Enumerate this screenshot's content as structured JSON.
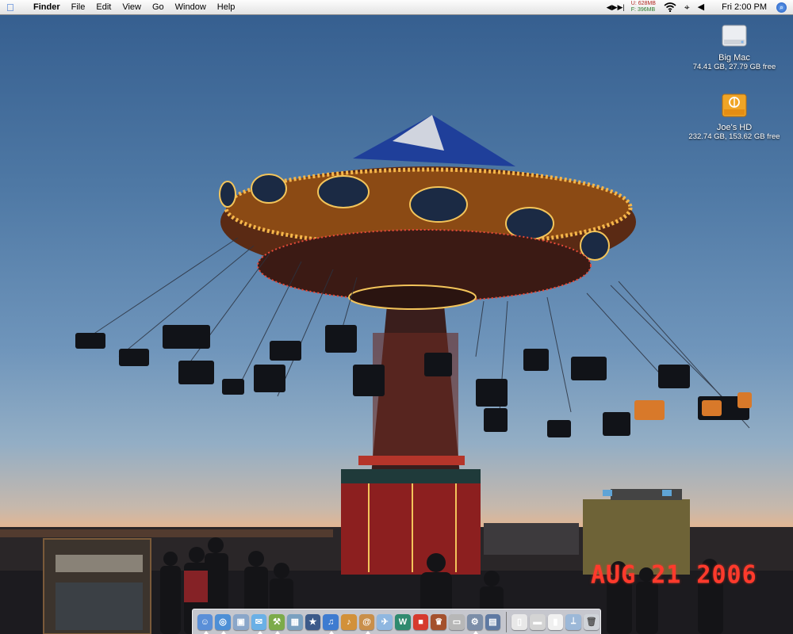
{
  "menubar": {
    "apple_icon": "apple-icon",
    "items": [
      "Finder",
      "File",
      "Edit",
      "View",
      "Go",
      "Window",
      "Help"
    ],
    "memory_used_label": "U:",
    "memory_used": "628MB",
    "memory_free_label": "F:",
    "memory_free": "396MB",
    "clock": "Fri 2:00 PM",
    "tray_icons": [
      "itunes-controls-icon",
      "wifi-icon",
      "bluetooth-icon",
      "volume-icon",
      "spotlight-icon"
    ]
  },
  "desktop": {
    "wallpaper": "swing-carousel-at-dusk",
    "date_stamp": "AUG 21 2006",
    "drives": [
      {
        "name": "Big Mac",
        "info": "74.41 GB, 27.79 GB free",
        "icon": "internal-hard-drive-icon"
      },
      {
        "name": "Joe's HD",
        "info": "232.74 GB, 153.62 GB free",
        "icon": "firewire-drive-icon"
      }
    ]
  },
  "dock": {
    "apps": [
      {
        "name": "Finder",
        "icon": "finder-icon",
        "color": "#5a8fd8",
        "glyph": "☺",
        "running": true
      },
      {
        "name": "Safari",
        "icon": "safari-icon",
        "color": "#4d8fd6",
        "glyph": "◎",
        "running": true
      },
      {
        "name": "Preview",
        "icon": "preview-icon",
        "color": "#8aa6c9",
        "glyph": "▣",
        "running": false
      },
      {
        "name": "iChat",
        "icon": "ichat-icon",
        "color": "#6ab0e6",
        "glyph": "✉",
        "running": true
      },
      {
        "name": "Xcode",
        "icon": "xcode-icon",
        "color": "#7cab4a",
        "glyph": "⚒",
        "running": true
      },
      {
        "name": "iPhoto",
        "icon": "iphoto-icon",
        "color": "#7aa0c0",
        "glyph": "▦",
        "running": false
      },
      {
        "name": "iMovie",
        "icon": "imovie-icon",
        "color": "#3c5a8a",
        "glyph": "★",
        "running": false
      },
      {
        "name": "iTunes",
        "icon": "itunes-icon",
        "color": "#3e7bd0",
        "glyph": "♫",
        "running": true
      },
      {
        "name": "GarageBand",
        "icon": "garageband-icon",
        "color": "#d2913a",
        "glyph": "♪",
        "running": false
      },
      {
        "name": "Address Book",
        "icon": "address-book-icon",
        "color": "#c98f4a",
        "glyph": "@",
        "running": true
      },
      {
        "name": "Mail",
        "icon": "mail-icon",
        "color": "#8fb7e0",
        "glyph": "✈",
        "running": false
      },
      {
        "name": "Dashboard",
        "icon": "dashboard-icon",
        "color": "#2f8a6f",
        "glyph": "W",
        "running": false
      },
      {
        "name": "Lego",
        "icon": "lego-icon",
        "color": "#d63a2e",
        "glyph": "■",
        "running": false
      },
      {
        "name": "Game",
        "icon": "game-icon",
        "color": "#a4512d",
        "glyph": "♛",
        "running": false
      },
      {
        "name": "Boot Camp",
        "icon": "bootcamp-icon",
        "color": "#b7b7b7",
        "glyph": "▭",
        "running": false
      },
      {
        "name": "System Preferences",
        "icon": "system-preferences-icon",
        "color": "#7c8ea8",
        "glyph": "⚙",
        "running": true
      },
      {
        "name": "Photo Booth",
        "icon": "photo-booth-icon",
        "color": "#5e79a2",
        "glyph": "▤",
        "running": false
      }
    ],
    "docs": [
      {
        "name": "Document",
        "icon": "document-icon",
        "color": "#e8e8e8",
        "glyph": "▯"
      },
      {
        "name": "Window",
        "icon": "window-icon",
        "color": "#d4d4d4",
        "glyph": "▬"
      },
      {
        "name": "Page",
        "icon": "page-icon",
        "color": "#f0f0f0",
        "glyph": "▮"
      },
      {
        "name": "Applications",
        "icon": "applications-folder-icon",
        "color": "#9cb8d8",
        "glyph": "⟘"
      },
      {
        "name": "Trash",
        "icon": "trash-icon",
        "color": "#cfd3d8",
        "glyph": "🗑"
      }
    ]
  }
}
